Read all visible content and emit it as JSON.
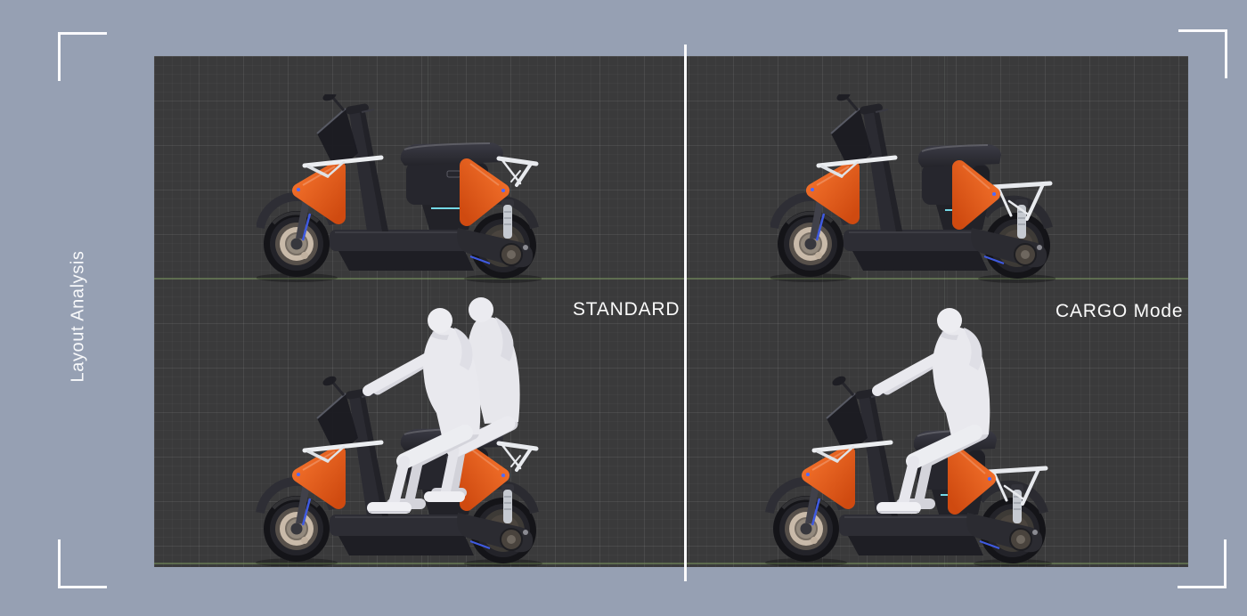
{
  "frame": {
    "title": "Layout Analysis"
  },
  "labels": {
    "standard": "STANDARD",
    "cargo": "CARGO Mode"
  },
  "viewport": {
    "background": "#3a3a3b",
    "grid_minor": "rgba(255,255,255,0.026)",
    "grid_major": "rgba(255,255,255,0.05)",
    "ground_axis_color": "#76915c",
    "divider_color": "#fbfbfd"
  },
  "page": {
    "background": "#96a0b3",
    "frame_mark_color": "#fafafc",
    "text_color": "#fafafa"
  },
  "colors": {
    "accent_orange": "#e55b1c",
    "body_dark": "#26262c",
    "chrome_white": "#eceef1",
    "rider_white": "#e9e9ee",
    "accent_blue": "#3f5ae0",
    "accent_cyan": "#74d8e6",
    "hub_beige": "#c9baa9"
  },
  "views": [
    {
      "name": "standard-scooter-empty",
      "mode": "standard",
      "riders": 0,
      "position": "top-left"
    },
    {
      "name": "cargo-scooter-empty",
      "mode": "cargo",
      "riders": 0,
      "position": "top-right"
    },
    {
      "name": "standard-scooter-two-riders",
      "mode": "standard",
      "riders": 2,
      "position": "bottom-left"
    },
    {
      "name": "cargo-scooter-one-rider",
      "mode": "cargo",
      "riders": 1,
      "position": "bottom-right"
    }
  ]
}
